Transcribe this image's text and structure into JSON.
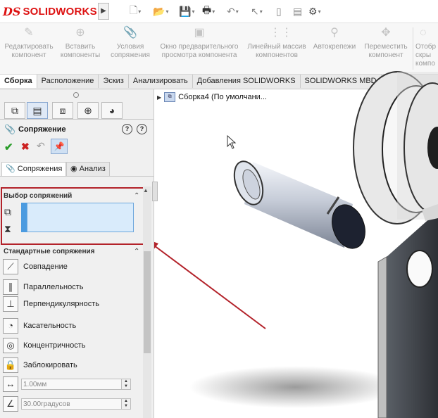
{
  "app": {
    "logo_ds": "DS",
    "logo_name": "SOLIDWORKS"
  },
  "ribbon": {
    "commands": [
      {
        "label": "Редактировать компонент",
        "icon": "edit-component-icon"
      },
      {
        "label": "Вставить компоненты",
        "icon": "insert-components-icon"
      },
      {
        "label": "Условия сопряжения",
        "icon": "mate-icon"
      },
      {
        "label": "Окно предварительного просмотра компонента",
        "icon": "preview-window-icon"
      },
      {
        "label": "Линейный массив компонентов",
        "icon": "linear-pattern-icon"
      },
      {
        "label": "Автокрепежи",
        "icon": "smart-fasteners-icon"
      },
      {
        "label": "Переместить компонент",
        "icon": "move-component-icon"
      },
      {
        "label": "Отобр скры компо",
        "icon": "show-hidden-icon"
      }
    ]
  },
  "tabs": [
    {
      "label": "Сборка",
      "active": true
    },
    {
      "label": "Расположение",
      "active": false
    },
    {
      "label": "Эскиз",
      "active": false
    },
    {
      "label": "Анализировать",
      "active": false
    },
    {
      "label": "Добавления SOLIDWORKS",
      "active": false
    },
    {
      "label": "SOLIDWORKS MBD",
      "active": false
    }
  ],
  "property_manager": {
    "title": "Сопряжение",
    "subtabs": {
      "mates": "Сопряжения",
      "analysis": "Анализ"
    },
    "selection_header": "Выбор сопряжений",
    "standard_header": "Стандартные сопряжения",
    "mates": [
      {
        "label": "Совпадение",
        "icon": "coincident-icon",
        "glyph": "⟋"
      },
      {
        "label": "Параллельность",
        "icon": "parallel-icon",
        "glyph": "∥"
      },
      {
        "label": "Перпендикулярность",
        "icon": "perpendicular-icon",
        "glyph": "⊥"
      },
      {
        "label": "Касательность",
        "icon": "tangent-icon",
        "glyph": "◔"
      },
      {
        "label": "Концентричность",
        "icon": "concentric-icon",
        "glyph": "◎"
      },
      {
        "label": "Заблокировать",
        "icon": "lock-icon",
        "glyph": "🔒"
      }
    ],
    "distance_value": "1.00мм",
    "angle_value": "30.00градусов"
  },
  "feature_tree": {
    "root": "Сборка4 (По умолчани..."
  }
}
